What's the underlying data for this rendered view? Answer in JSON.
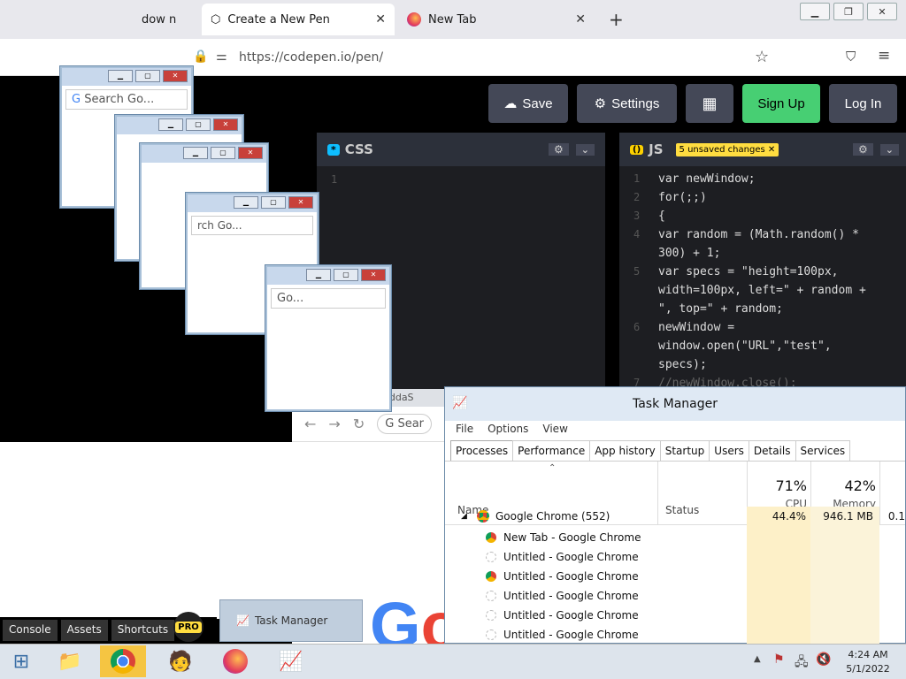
{
  "browser": {
    "tabs": [
      {
        "label": "dow n",
        "active": false
      },
      {
        "label": "Create a New Pen",
        "active": true
      },
      {
        "label": "New Tab",
        "active": false
      }
    ],
    "url": "https://codepen.io/pen/"
  },
  "codepen": {
    "buttons": {
      "save": "Save",
      "settings": "Settings",
      "signup": "Sign Up",
      "login": "Log In"
    },
    "css_editor": {
      "title": "CSS",
      "line": "1"
    },
    "js_editor": {
      "title": "JS",
      "unsaved": "5 unsaved changes",
      "lines": [
        {
          "n": "1",
          "code": "var newWindow;"
        },
        {
          "n": "2",
          "code": "for(;;)"
        },
        {
          "n": "3",
          "code": "{"
        },
        {
          "n": "4",
          "code": "var random = (Math.random() *"
        },
        {
          "n": "",
          "code": "300) + 1;"
        },
        {
          "n": "5",
          "code": "var specs = \"height=100px,"
        },
        {
          "n": "",
          "code": "width=100px, left=\" + random +"
        },
        {
          "n": "",
          "code": "\", top=\" + random;"
        },
        {
          "n": "6",
          "code": "newWindow ="
        },
        {
          "n": "",
          "code": "window.open(\"URL\",\"test\","
        },
        {
          "n": "",
          "code": "specs);"
        },
        {
          "n": "7",
          "code": "//newWindow.close();"
        }
      ]
    },
    "footer": {
      "console": "Console",
      "assets": "Assets",
      "shortcuts": "Shortcuts",
      "pro": "PRO"
    }
  },
  "popups": {
    "search_placeholder": "Search Go...",
    "search_partial": "rch Go...",
    "go_partial": "Go..."
  },
  "background_chrome": {
    "tab": "98 Classic from SaddaS",
    "search": "Sear"
  },
  "task_manager": {
    "title": "Task Manager",
    "menu": [
      "File",
      "Options",
      "View"
    ],
    "tabs": [
      "Processes",
      "Performance",
      "App history",
      "Startup",
      "Users",
      "Details",
      "Services"
    ],
    "columns": {
      "name": "Name",
      "status": "Status",
      "cpu_pct": "71%",
      "cpu": "CPU",
      "mem_pct": "42%",
      "memory": "Memory",
      "extra": "0.1"
    },
    "group": {
      "name": "Google Chrome (552)",
      "cpu": "44.4%",
      "memory": "946.1 MB"
    },
    "rows": [
      "New Tab - Google Chrome",
      "Untitled - Google Chrome",
      "Untitled - Google Chrome",
      "Untitled - Google Chrome",
      "Untitled - Google Chrome",
      "Untitled - Google Chrome"
    ]
  },
  "taskbar": {
    "task_manager_label": "Task Manager",
    "time": "4:24 AM",
    "date": "5/1/2022"
  },
  "colors": {
    "signup": "#47cf73",
    "codepen_bg": "#000000",
    "editor_bg": "#1d1e22",
    "unsaved": "#ffdd40"
  }
}
